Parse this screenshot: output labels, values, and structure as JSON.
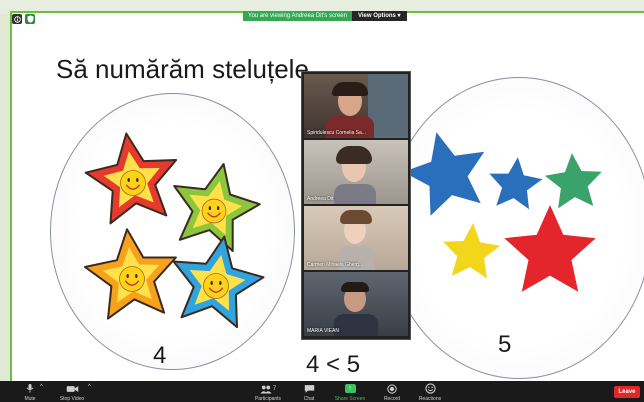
{
  "window": {
    "banner_viewing": "You are viewing Andreea Dit's screen",
    "view_options": "View Options ▾"
  },
  "slide": {
    "title": "Să numărăm steluțele",
    "left_count": "4",
    "right_count": "5",
    "comparison": "4 < 5",
    "left_star_colors": [
      "#e63a2e",
      "#8cc63f",
      "#f6a21d",
      "#2fa4e0"
    ],
    "right_star_colors": [
      "#2a6fbb",
      "#2a6fbb",
      "#3aa36b",
      "#f2d61b",
      "#e4252b"
    ]
  },
  "gallery": {
    "participants": [
      {
        "name": "Spiridulescu Cornelia Sa..."
      },
      {
        "name": "Andreea Dit"
      },
      {
        "name": "Carmen Mihaela Gherg..."
      },
      {
        "name": "MARIA VIEAN"
      }
    ]
  },
  "toolbar": {
    "mute": "Mute",
    "stop_video": "Stop Video",
    "participants": "Participants",
    "participants_count": "7",
    "chat": "Chat",
    "share_screen": "Share Screen",
    "record": "Record",
    "reactions": "Reactions",
    "leave": "Leave"
  }
}
